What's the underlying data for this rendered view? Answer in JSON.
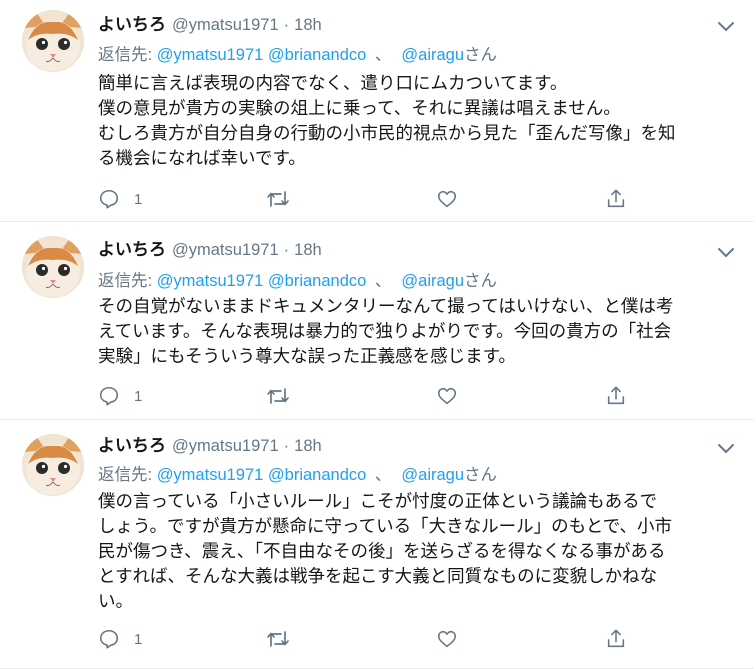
{
  "tweets": [
    {
      "display_name": "よいちろ",
      "handle": "@ymatsu1971",
      "separator": "·",
      "time": "18h",
      "reply_prefix": "返信先:",
      "mention_1": "@ymatsu1971",
      "mention_2": "@brianandco",
      "mention_sep": "、",
      "mention_3": "@airagu",
      "mention_suffix": "さん",
      "lines": [
        "簡単に言えば表現の内容でなく、遣り口にムカついてます。",
        "僕の意見が貴方の実験の俎上に乗って、それに異議は唱えません。",
        "むしろ貴方が自分自身の行動の小市民的視点から見た「歪んだ写像」を知",
        "る機会になれば幸いです。"
      ],
      "reply_count": "1"
    },
    {
      "display_name": "よいちろ",
      "handle": "@ymatsu1971",
      "separator": "·",
      "time": "18h",
      "reply_prefix": "返信先:",
      "mention_1": "@ymatsu1971",
      "mention_2": "@brianandco",
      "mention_sep": "、",
      "mention_3": "@airagu",
      "mention_suffix": "さん",
      "lines": [
        "その自覚がないままドキュメンタリーなんて撮ってはいけない、と僕は考",
        "えています。そんな表現は暴力的で独りよがりです。今回の貴方の「社会",
        "実験」にもそういう尊大な誤った正義感を感じます。"
      ],
      "reply_count": "1"
    },
    {
      "display_name": "よいちろ",
      "handle": "@ymatsu1971",
      "separator": "·",
      "time": "18h",
      "reply_prefix": "返信先:",
      "mention_1": "@ymatsu1971",
      "mention_2": "@brianandco",
      "mention_sep": "、",
      "mention_3": "@airagu",
      "mention_suffix": "さん",
      "lines": [
        "僕の言っている「小さいルール」こそが忖度の正体という議論もあるで",
        "しょう。ですが貴方が懸命に守っている「大きなルール」のもとで、小市",
        "民が傷つき、震え、「不自由なその後」を送らざるを得なくなる事がある",
        "とすれば、そんな大義は戦争を起こす大義と同質なものに変貌しかねな",
        "い。"
      ],
      "reply_count": "1"
    }
  ],
  "icons": {
    "caret": "chevron-down-icon",
    "reply": "reply-icon",
    "retweet": "retweet-icon",
    "like": "heart-icon",
    "share": "share-icon"
  },
  "colors": {
    "link": "#1da1f2",
    "muted": "#657786",
    "text": "#14171a",
    "divider": "#e6ecf0"
  }
}
